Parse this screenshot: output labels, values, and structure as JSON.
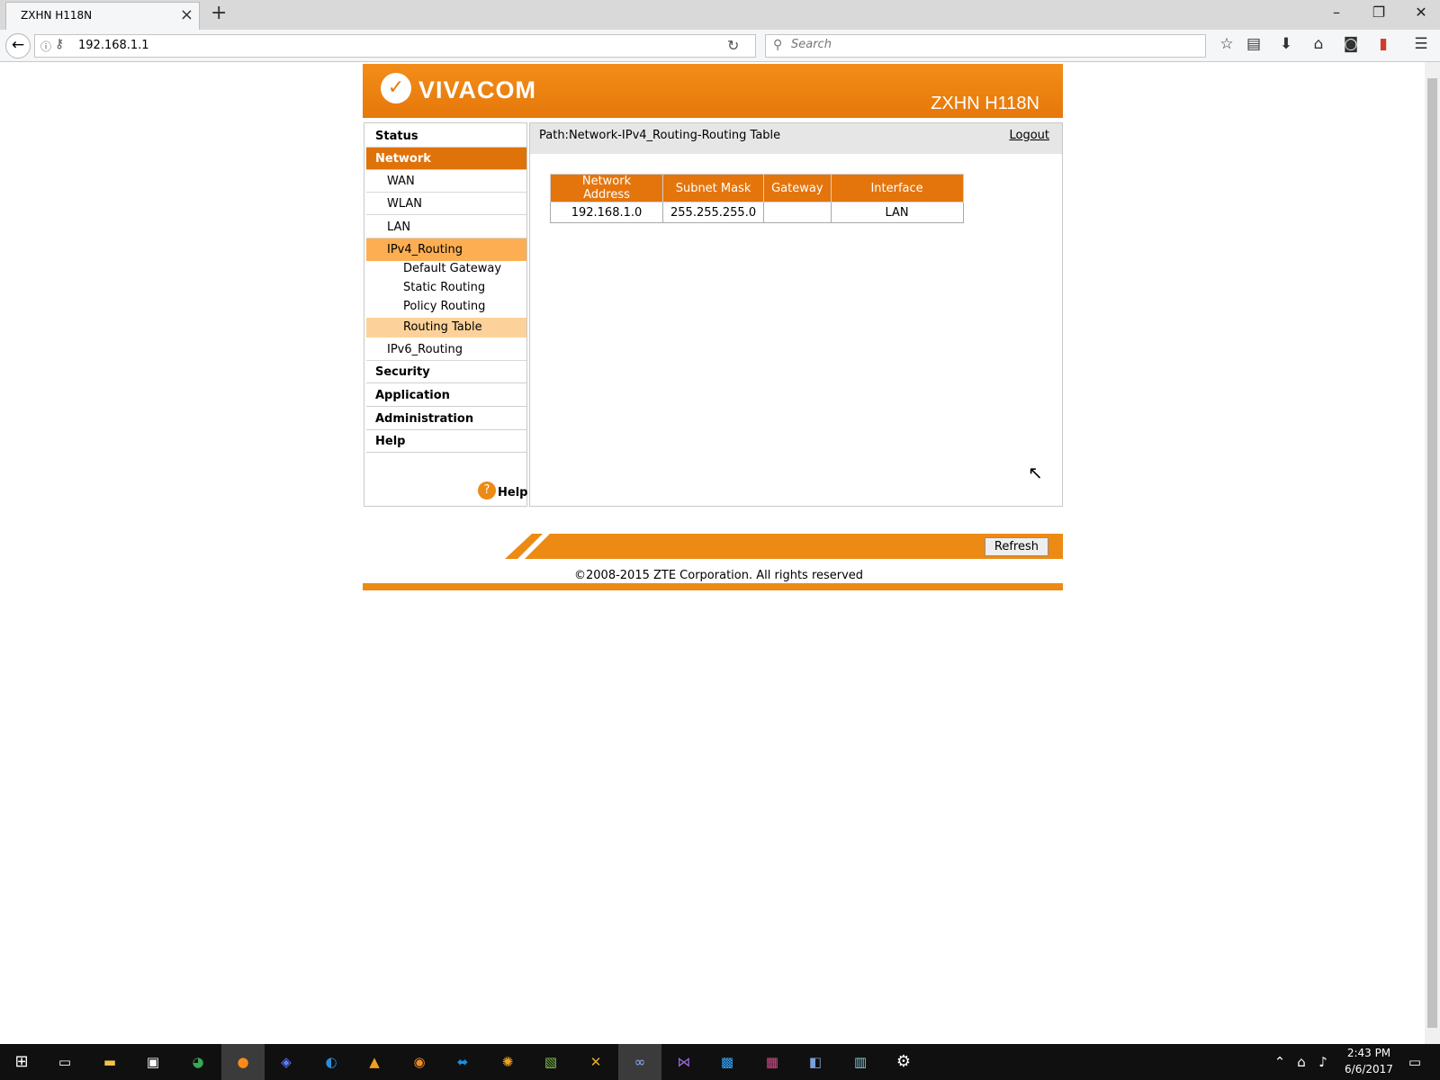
{
  "browser": {
    "tab_title": "ZXHN H118N",
    "url": "192.168.1.1",
    "search_placeholder": "Search"
  },
  "header": {
    "brand": "VIVACOM",
    "model": "ZXHN H118N"
  },
  "sidebar": {
    "status": "Status",
    "network": "Network",
    "wan": "WAN",
    "wlan": "WLAN",
    "lan": "LAN",
    "ipv4_routing": "IPv4_Routing",
    "default_gateway": "Default Gateway",
    "static_routing": "Static Routing",
    "policy_routing": "Policy Routing",
    "routing_table": "Routing Table",
    "ipv6_routing": "IPv6_Routing",
    "security": "Security",
    "application": "Application",
    "administration": "Administration",
    "help": "Help",
    "help_link": "Help"
  },
  "content": {
    "path": "Path:Network-IPv4_Routing-Routing Table",
    "logout": "Logout",
    "table": {
      "headers": [
        "Network Address",
        "Subnet Mask",
        "Gateway",
        "Interface"
      ],
      "rows": [
        [
          "192.168.1.0",
          "255.255.255.0",
          "",
          "LAN"
        ]
      ]
    }
  },
  "footer": {
    "refresh": "Refresh",
    "copyright": "©2008-2015 ZTE Corporation. All rights reserved"
  },
  "taskbar": {
    "time": "2:43 PM",
    "date": "6/6/2017"
  }
}
